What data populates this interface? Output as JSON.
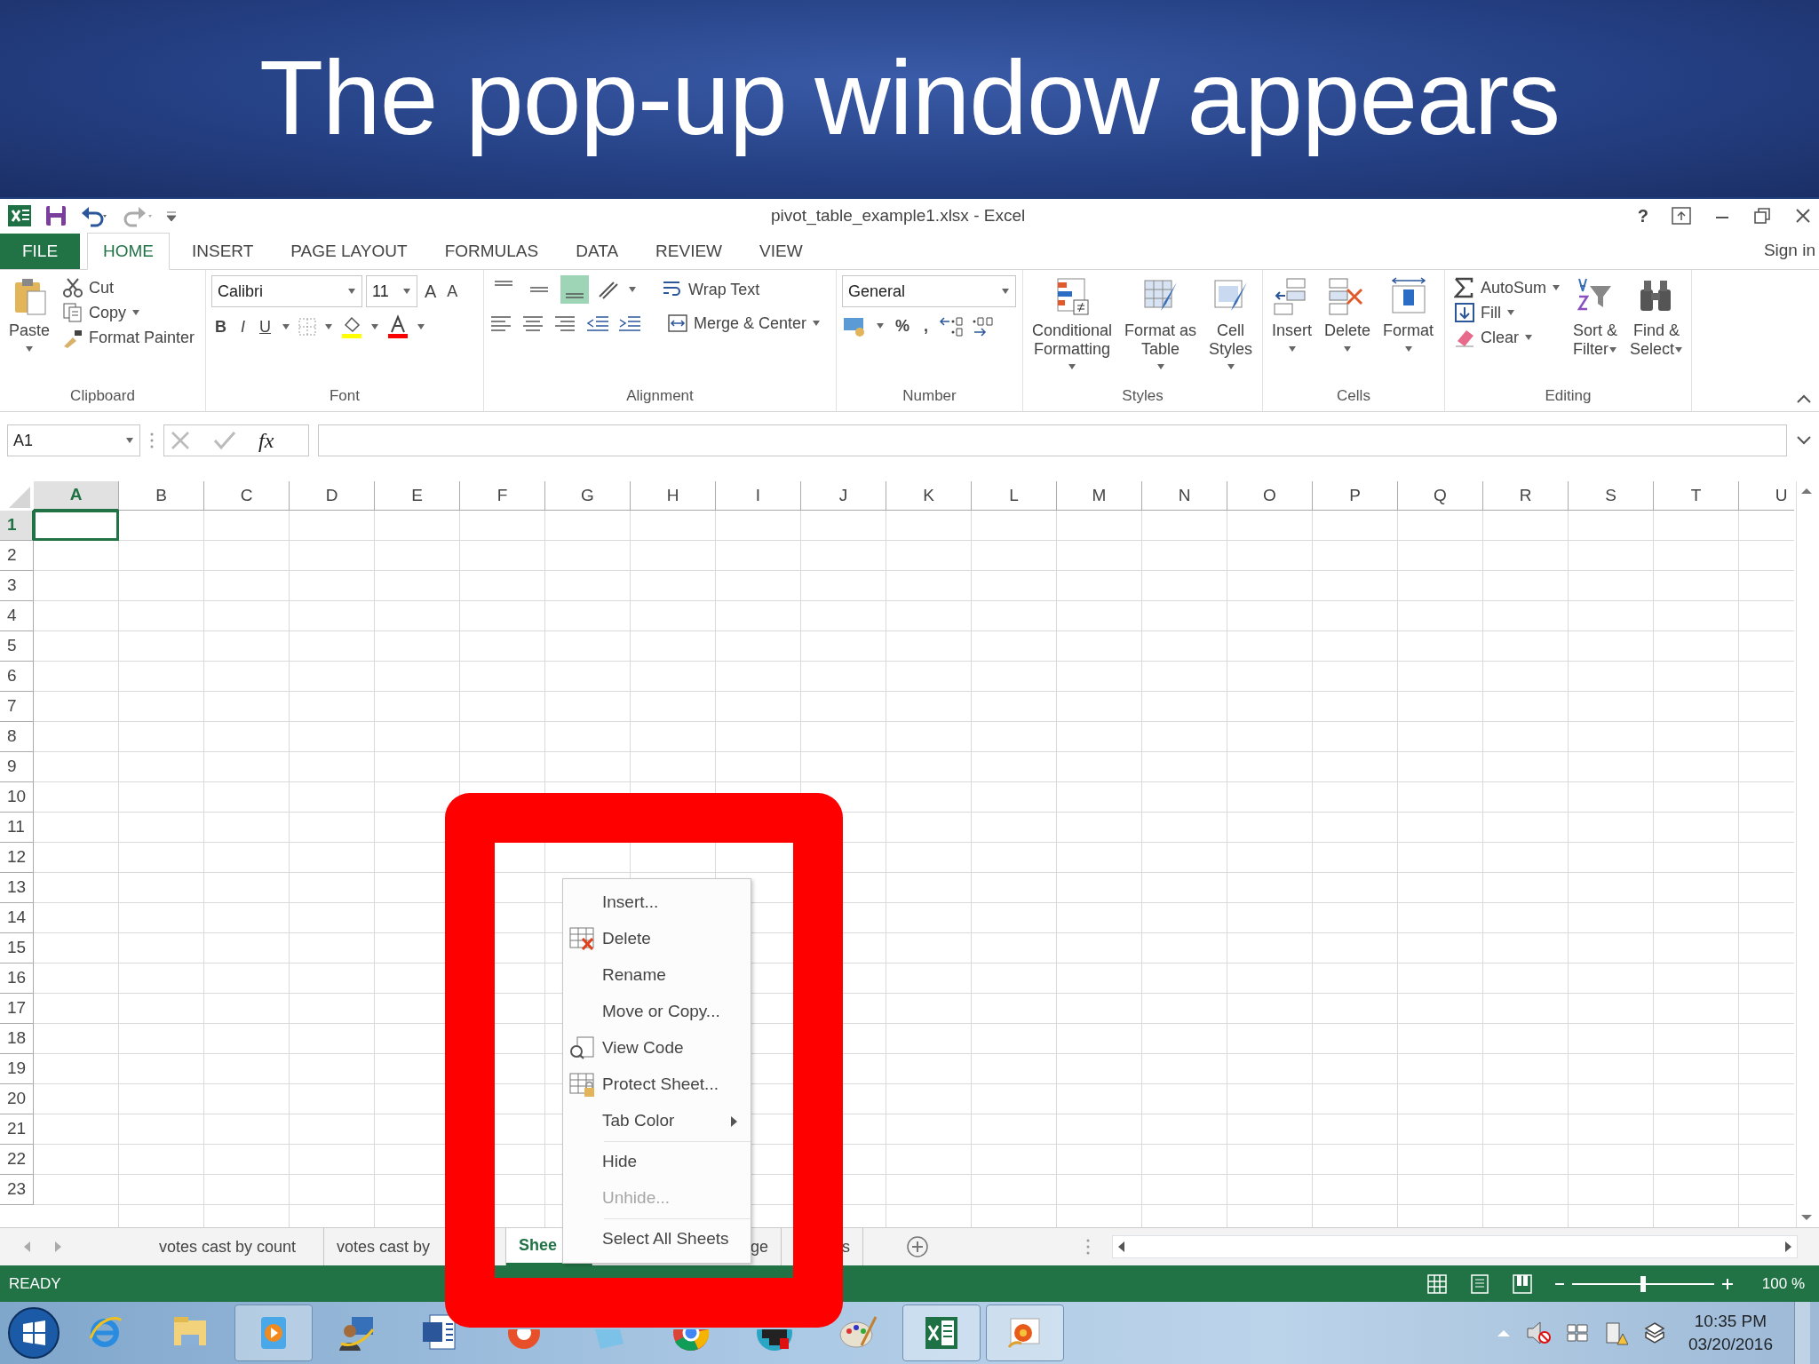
{
  "slide_title": "The pop-up window appears",
  "window": {
    "title": "pivot_table_example1.xlsx - Excel",
    "help": "?",
    "sign_in": "Sign in"
  },
  "ribbon_tabs": [
    {
      "label": "FILE",
      "kind": "file",
      "selected": false
    },
    {
      "label": "HOME",
      "kind": "tab",
      "selected": true
    },
    {
      "label": "INSERT",
      "kind": "tab",
      "selected": false
    },
    {
      "label": "PAGE LAYOUT",
      "kind": "tab",
      "selected": false
    },
    {
      "label": "FORMULAS",
      "kind": "tab",
      "selected": false
    },
    {
      "label": "DATA",
      "kind": "tab",
      "selected": false
    },
    {
      "label": "REVIEW",
      "kind": "tab",
      "selected": false
    },
    {
      "label": "VIEW",
      "kind": "tab",
      "selected": false
    }
  ],
  "ribbon_groups": [
    {
      "kind": "clipboard",
      "label": "Clipboard",
      "big": "Paste",
      "small": [
        "Cut",
        "Copy",
        "Format Painter"
      ]
    },
    {
      "kind": "font",
      "label": "Font",
      "font_name": "Calibri",
      "font_size": "11",
      "grow": "A",
      "shrink": "A",
      "bold": "B",
      "italic": "I",
      "underline": "U"
    },
    {
      "kind": "alignment",
      "label": "Alignment",
      "vertical_align": [
        {
          "selected": false
        },
        {
          "selected": false
        },
        {
          "selected": true
        }
      ],
      "wrap": "Wrap Text",
      "merge": "Merge & Center"
    },
    {
      "kind": "number",
      "label": "Number",
      "format": "General",
      "percent": "%",
      "comma": ","
    },
    {
      "kind": "styles",
      "label": "Styles",
      "buttons": [
        {
          "lines": [
            "Conditional",
            "Formatting"
          ]
        },
        {
          "lines": [
            "Format as",
            "Table"
          ]
        },
        {
          "lines": [
            "Cell",
            "Styles"
          ]
        }
      ]
    },
    {
      "kind": "cells",
      "label": "Cells",
      "buttons": [
        {
          "lines": [
            "Insert"
          ]
        },
        {
          "lines": [
            "Delete"
          ]
        },
        {
          "lines": [
            "Format"
          ]
        }
      ]
    },
    {
      "kind": "editing",
      "label": "Editing",
      "small": [
        "AutoSum",
        "Fill",
        "Clear"
      ],
      "buttons": [
        {
          "lines": [
            "Sort &",
            "Filter"
          ]
        },
        {
          "lines": [
            "Find &",
            "Select"
          ]
        }
      ]
    }
  ],
  "formula_bar": {
    "name_box": "A1",
    "fx": "fx"
  },
  "sheet": {
    "columns": [
      {
        "label": "A",
        "selected": true
      },
      {
        "label": "B",
        "selected": false
      },
      {
        "label": "C",
        "selected": false
      },
      {
        "label": "D",
        "selected": false
      },
      {
        "label": "E",
        "selected": false
      },
      {
        "label": "F",
        "selected": false
      },
      {
        "label": "G",
        "selected": false
      },
      {
        "label": "H",
        "selected": false
      },
      {
        "label": "I",
        "selected": false
      },
      {
        "label": "J",
        "selected": false
      },
      {
        "label": "K",
        "selected": false
      },
      {
        "label": "L",
        "selected": false
      },
      {
        "label": "M",
        "selected": false
      },
      {
        "label": "N",
        "selected": false
      },
      {
        "label": "O",
        "selected": false
      },
      {
        "label": "P",
        "selected": false
      },
      {
        "label": "Q",
        "selected": false
      },
      {
        "label": "R",
        "selected": false
      },
      {
        "label": "S",
        "selected": false
      },
      {
        "label": "T",
        "selected": false
      },
      {
        "label": "U",
        "selected": false
      }
    ],
    "rows": [
      {
        "label": "1",
        "selected": true
      },
      {
        "label": "2",
        "selected": false
      },
      {
        "label": "3",
        "selected": false
      },
      {
        "label": "4",
        "selected": false
      },
      {
        "label": "5",
        "selected": false
      },
      {
        "label": "6",
        "selected": false
      },
      {
        "label": "7",
        "selected": false
      },
      {
        "label": "8",
        "selected": false
      },
      {
        "label": "9",
        "selected": false
      },
      {
        "label": "10",
        "selected": false
      },
      {
        "label": "11",
        "selected": false
      },
      {
        "label": "12",
        "selected": false
      },
      {
        "label": "13",
        "selected": false
      },
      {
        "label": "14",
        "selected": false
      },
      {
        "label": "15",
        "selected": false
      },
      {
        "label": "16",
        "selected": false
      },
      {
        "label": "17",
        "selected": false
      },
      {
        "label": "18",
        "selected": false
      },
      {
        "label": "19",
        "selected": false
      },
      {
        "label": "20",
        "selected": false
      },
      {
        "label": "21",
        "selected": false
      },
      {
        "label": "22",
        "selected": false
      },
      {
        "label": "23",
        "selected": false
      }
    ]
  },
  "context_menu": {
    "groups": [
      [
        {
          "label": "Insert...",
          "kind": "plain",
          "disabled": false
        },
        {
          "label": "Delete",
          "kind": "delete",
          "disabled": false
        },
        {
          "label": "Rename",
          "kind": "plain",
          "disabled": false
        },
        {
          "label": "Move or Copy...",
          "kind": "plain",
          "disabled": false
        },
        {
          "label": "View Code",
          "kind": "view",
          "disabled": false
        },
        {
          "label": "Protect Sheet...",
          "kind": "protect",
          "disabled": false
        },
        {
          "label": "Tab Color",
          "kind": "submenu",
          "disabled": false
        }
      ],
      [
        {
          "label": "Hide",
          "kind": "plain",
          "disabled": false
        },
        {
          "label": "Unhide...",
          "kind": "plain",
          "disabled": true
        }
      ],
      [
        {
          "label": "Select All Sheets",
          "kind": "plain",
          "disabled": false
        }
      ]
    ]
  },
  "sheet_tabs": [
    {
      "label": "votes cast by count",
      "selected": false
    },
    {
      "label": "votes cast by",
      "selected": false
    },
    {
      "label": "Shee",
      "selected": true
    },
    {
      "label": "ge",
      "selected": false
    },
    {
      "label": "s",
      "selected": false
    }
  ],
  "status_bar": {
    "mode": "READY",
    "zoom": {
      "level": 0.5,
      "reading": "100 %"
    }
  },
  "taskbar": {
    "time": "10:35 PM",
    "date": "03/20/2016"
  },
  "highlight_frame": {
    "shown": true
  }
}
